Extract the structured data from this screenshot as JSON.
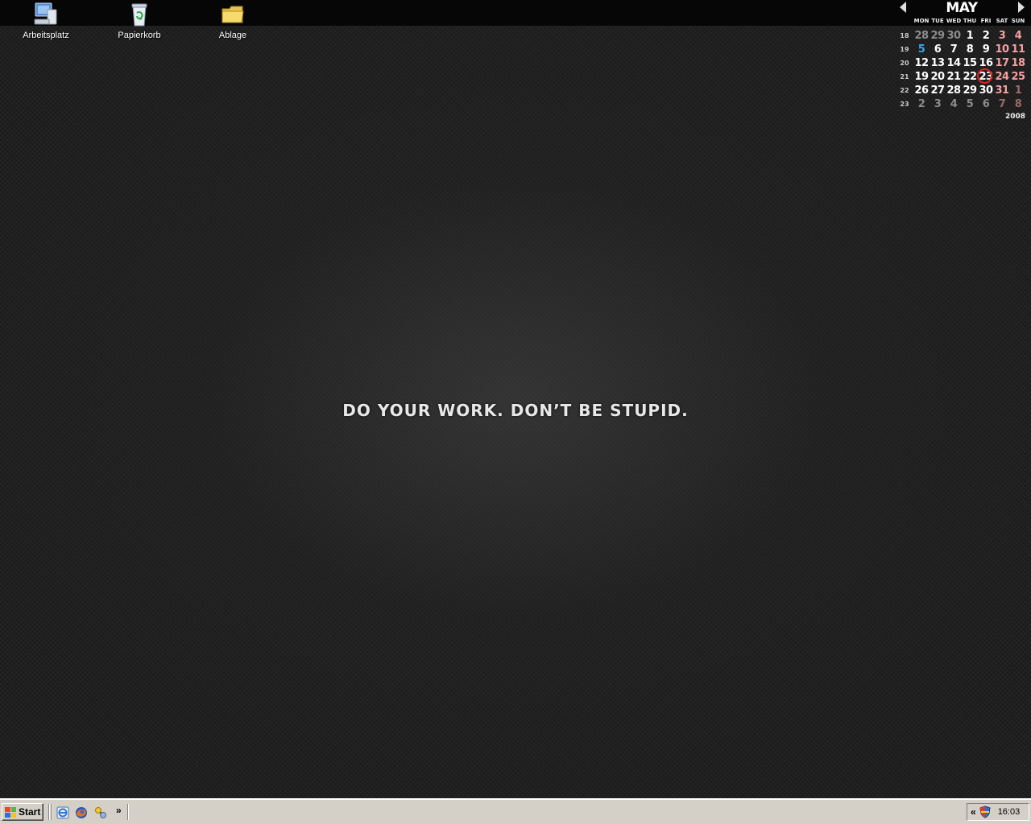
{
  "desktop": {
    "slogan": "DO YOUR WORK. DON’T BE STUPID.",
    "icons": [
      {
        "label": "Arbeitsplatz",
        "icon": "my-computer-icon"
      },
      {
        "label": "Papierkorb",
        "icon": "recycle-bin-icon"
      },
      {
        "label": "Ablage",
        "icon": "folder-icon"
      }
    ]
  },
  "calendar": {
    "month": "MAY",
    "year": "2008",
    "weekdays": [
      "MON",
      "TUE",
      "WED",
      "THU",
      "FRI",
      "SAT",
      "SUN"
    ],
    "weeks": [
      {
        "week": "18",
        "days": [
          "28",
          "29",
          "30",
          "1",
          "2",
          "3",
          "4"
        ]
      },
      {
        "week": "19",
        "days": [
          "5",
          "6",
          "7",
          "8",
          "9",
          "10",
          "11"
        ]
      },
      {
        "week": "20",
        "days": [
          "12",
          "13",
          "14",
          "15",
          "16",
          "17",
          "18"
        ]
      },
      {
        "week": "21",
        "days": [
          "19",
          "20",
          "21",
          "22",
          "23",
          "24",
          "25"
        ]
      },
      {
        "week": "22",
        "days": [
          "26",
          "27",
          "28",
          "29",
          "30",
          "31",
          "1"
        ]
      },
      {
        "week": "23",
        "days": [
          "2",
          "3",
          "4",
          "5",
          "6",
          "7",
          "8"
        ]
      }
    ],
    "today": "23",
    "colors": {
      "today_ring": "#e02020",
      "weekend": "#f4a0a0",
      "holiday": "#33aaee"
    }
  },
  "taskbar": {
    "start_label": "Start",
    "quick_launch": [
      "ie-icon",
      "firefox-icon",
      "network-icon"
    ],
    "more_label": "»",
    "tray_expand_label": "«",
    "clock": "16:03"
  }
}
